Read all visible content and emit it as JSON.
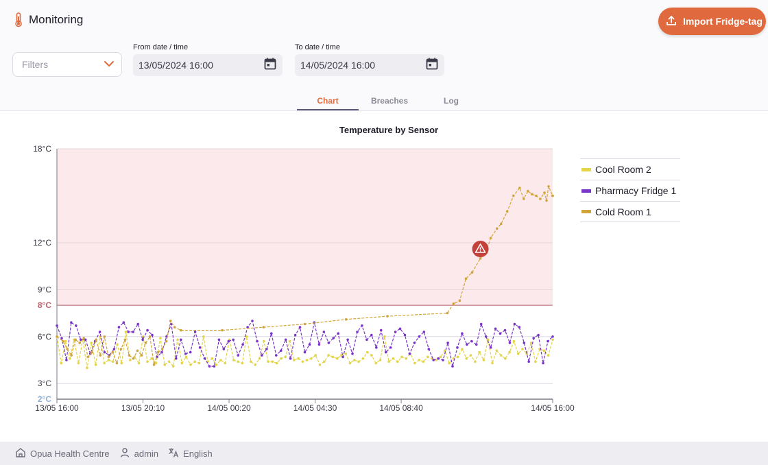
{
  "header": {
    "title": "Monitoring",
    "title_icon": "thermometer-icon",
    "import_button": "Import Fridge-tag",
    "accent_color": "#e0693e"
  },
  "filters": {
    "label": "Filters"
  },
  "date_range": {
    "from_label": "From date / time",
    "from_value": "13/05/2024 16:00",
    "to_label": "To date / time",
    "to_value": "14/05/2024 16:00"
  },
  "tabs": [
    {
      "label": "Chart",
      "active": true
    },
    {
      "label": "Breaches",
      "active": false
    },
    {
      "label": "Log",
      "active": false
    }
  ],
  "chart_data": {
    "type": "line",
    "title": "Temperature by Sensor",
    "xlabel": "",
    "ylabel": "",
    "x_range": [
      "13/05 16:00",
      "14/05 16:00"
    ],
    "x_ticks": [
      {
        "label": "13/05 16:00",
        "hours": 0
      },
      {
        "label": "13/05 20:10",
        "hours": 4.1667
      },
      {
        "label": "14/05 00:20",
        "hours": 8.3333
      },
      {
        "label": "14/05 04:30",
        "hours": 12.5
      },
      {
        "label": "14/05 08:40",
        "hours": 16.6667
      },
      {
        "label": "14/05 16:00",
        "hours": 24
      }
    ],
    "ylim": [
      2,
      18
    ],
    "y_ticks": [
      {
        "value": 18,
        "label": "18°C"
      },
      {
        "value": 12,
        "label": "12°C"
      },
      {
        "value": 9,
        "label": "9°C"
      },
      {
        "value": 8,
        "label": "8°C",
        "kind": "max"
      },
      {
        "value": 6,
        "label": "6°C"
      },
      {
        "value": 3,
        "label": "3°C"
      },
      {
        "value": 2,
        "label": "2°C",
        "kind": "min"
      }
    ],
    "breach_threshold": 8,
    "breach_zone_color": "#fbe9ec",
    "breach_marker": {
      "hours": 20.5,
      "value": 11.6
    },
    "legend_position": "right",
    "series": [
      {
        "name": "Cool Room 2",
        "color": "#e3d44a",
        "start_hours": 0,
        "end_hours": 24,
        "values": [
          6.0,
          4.3,
          5.7,
          4.6,
          5.8,
          4.3,
          5.8,
          4.0,
          5.6,
          4.2,
          6.0,
          4.3,
          4.5,
          4.4,
          5.5,
          4.3,
          6.3,
          4.5,
          4.7,
          4.3,
          6.0,
          4.4,
          4.6,
          4.3,
          5.9,
          4.2,
          4.4,
          4.1,
          5.8,
          4.3,
          4.7,
          4.2,
          4.4,
          4.3,
          6.0,
          4.4,
          4.6,
          4.2,
          4.5,
          4.3,
          5.8,
          4.5,
          4.4,
          4.3,
          6.0,
          4.4,
          4.2,
          4.6,
          5.7,
          4.4,
          4.4,
          4.3,
          4.6,
          4.7,
          5.7,
          4.5,
          4.6,
          4.4,
          4.5,
          4.6,
          4.8,
          4.2,
          4.4,
          4.8,
          4.7,
          4.6,
          4.8,
          4.9,
          4.3,
          4.5,
          4.4,
          4.6,
          5.0,
          4.8,
          4.3,
          4.5,
          6.0,
          4.4,
          4.6,
          4.4,
          4.7,
          4.6,
          4.9,
          4.3,
          4.5,
          4.4,
          4.7,
          4.6,
          4.5,
          4.7,
          5.1,
          4.3,
          4.6,
          4.7,
          5.2,
          4.6,
          4.8,
          4.4,
          5.0,
          4.5,
          5.8,
          4.3,
          5.1,
          4.8,
          4.6,
          5.0,
          5.7,
          4.9,
          5.2,
          4.9,
          5.6,
          4.4,
          5.2,
          5.1,
          4.8,
          5.8
        ]
      },
      {
        "name": "Pharmacy Fridge 1",
        "color": "#7a35c8",
        "start_hours": 0,
        "end_hours": 24,
        "values": [
          6.7,
          5.9,
          4.5,
          6.9,
          6.7,
          5.8,
          5.8,
          4.9,
          5.7,
          6.3,
          5.0,
          4.8,
          5.2,
          6.6,
          6.9,
          6.3,
          6.3,
          6.8,
          5.8,
          6.4,
          6.1,
          4.7,
          5.0,
          6.0,
          6.8,
          4.6,
          5.8,
          4.9,
          5.0,
          6.3,
          5.3,
          4.6,
          4.1,
          4.1,
          5.8,
          5.2,
          5.7,
          5.8,
          4.8,
          5.5,
          6.6,
          7.0,
          5.7,
          4.8,
          5.2,
          6.2,
          4.8,
          5.1,
          5.8,
          4.6,
          6.1,
          6.6,
          5.0,
          5.5,
          6.9,
          5.5,
          6.3,
          5.6,
          5.9,
          6.2,
          4.7,
          5.8,
          4.9,
          6.3,
          6.7,
          5.8,
          6.1,
          5.3,
          6.4,
          5.0,
          5.3,
          6.3,
          6.5,
          6.1,
          4.9,
          5.6,
          6.0,
          6.3,
          5.2,
          4.5,
          4.6,
          4.5,
          5.6,
          4.1,
          5.3,
          6.2,
          5.5,
          5.7,
          5.5,
          6.8,
          6.0,
          5.3,
          6.5,
          6.2,
          6.4,
          5.6,
          6.8,
          6.6,
          5.6,
          4.4,
          5.9,
          6.1,
          4.3,
          5.7,
          6.0
        ]
      },
      {
        "name": "Cold Room 1",
        "color": "#d1a53a",
        "start_hours": 0,
        "values": [
          [
            0.0,
            6.0
          ],
          [
            0.3,
            5.7
          ],
          [
            0.5,
            5.2
          ],
          [
            0.7,
            4.8
          ],
          [
            0.9,
            5.8
          ],
          [
            1.1,
            5.6
          ],
          [
            1.3,
            5.9
          ],
          [
            1.5,
            4.7
          ],
          [
            1.7,
            5.0
          ],
          [
            1.9,
            5.8
          ],
          [
            2.1,
            4.8
          ],
          [
            2.3,
            6.0
          ],
          [
            2.5,
            4.7
          ],
          [
            2.7,
            5.0
          ],
          [
            2.9,
            4.3
          ],
          [
            3.1,
            5.2
          ],
          [
            3.3,
            5.8
          ],
          [
            3.5,
            4.8
          ],
          [
            3.7,
            4.6
          ],
          [
            3.9,
            5.1
          ],
          [
            4.1,
            4.8
          ],
          [
            4.3,
            5.6
          ],
          [
            4.5,
            6.0
          ],
          [
            4.7,
            4.2
          ],
          [
            4.9,
            5.0
          ],
          [
            5.1,
            5.2
          ],
          [
            5.3,
            5.7
          ],
          [
            5.5,
            7.0
          ],
          [
            5.7,
            6.6
          ],
          [
            6.0,
            6.4
          ],
          [
            8.0,
            6.4
          ],
          [
            10.0,
            6.6
          ],
          [
            12.0,
            6.8
          ],
          [
            14.0,
            7.1
          ],
          [
            16.0,
            7.3
          ],
          [
            18.9,
            7.5
          ],
          [
            19.2,
            8.1
          ],
          [
            19.5,
            8.3
          ],
          [
            19.8,
            9.7
          ],
          [
            20.1,
            10.1
          ],
          [
            20.5,
            11.0
          ],
          [
            20.8,
            11.5
          ],
          [
            21.0,
            12.3
          ],
          [
            21.3,
            12.9
          ],
          [
            21.5,
            13.2
          ],
          [
            21.8,
            14.0
          ],
          [
            22.1,
            15.0
          ],
          [
            22.4,
            15.5
          ],
          [
            22.6,
            14.8
          ],
          [
            22.8,
            15.3
          ],
          [
            23.0,
            15.1
          ],
          [
            23.2,
            15.0
          ],
          [
            23.4,
            14.8
          ],
          [
            23.6,
            15.2
          ],
          [
            23.7,
            14.7
          ],
          [
            23.8,
            15.6
          ],
          [
            24.0,
            15.0
          ],
          [
            24.0,
            15.0
          ]
        ]
      }
    ]
  },
  "footer": {
    "store": "Opua Health Centre",
    "user": "admin",
    "language": "English"
  }
}
